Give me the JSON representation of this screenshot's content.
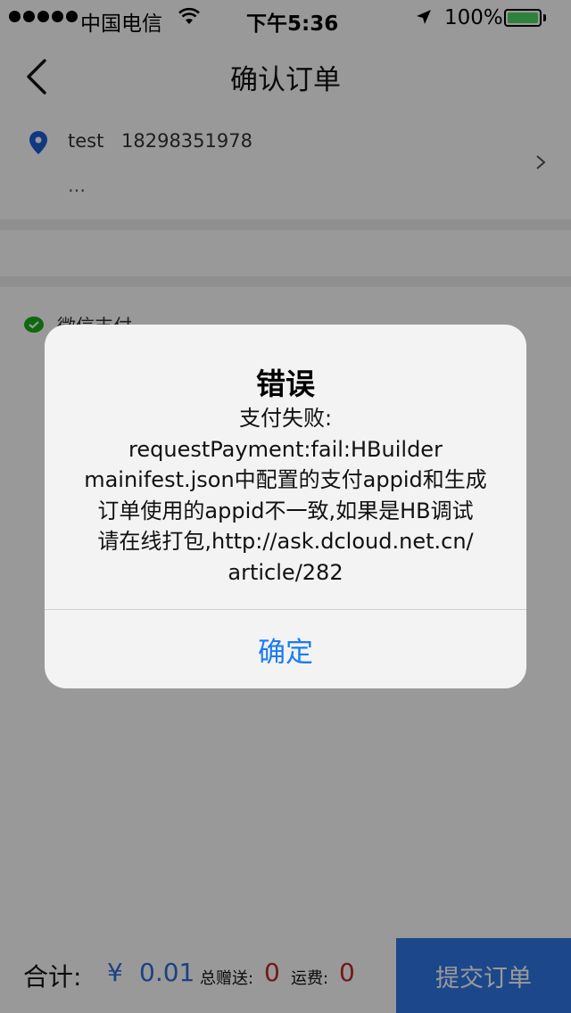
{
  "status_bar": {
    "carrier": "中国电信",
    "time": "下午5:36",
    "battery": "100%"
  },
  "nav": {
    "title": "确认订单"
  },
  "address": {
    "name": "test",
    "phone": "18298351978",
    "detail": "..."
  },
  "payment": {
    "label": "微信支付"
  },
  "footer": {
    "total_label": "合计:",
    "currency": "¥",
    "total_value": "0.01",
    "gift_label": "总赠送:",
    "gift_value": "0",
    "shipping_label": "运费:",
    "shipping_value": "0",
    "submit_label": "提交订单"
  },
  "dialog": {
    "title": "错误",
    "message_lines": [
      "支付失败:",
      "requestPayment:fail:HBuilder",
      "mainifest.json中配置的支付appid和生成",
      "订单使用的appid不一致,如果是HB调试",
      "请在线打包,http://ask.dcloud.net.cn/",
      "article/282"
    ],
    "confirm_label": "确定"
  },
  "colors": {
    "accent_blue": "#2f78e8",
    "dialog_button": "#1b7cf5",
    "price_red": "#c0282b",
    "battery_green": "#4cd964",
    "wechat_green": "#1aad19"
  }
}
